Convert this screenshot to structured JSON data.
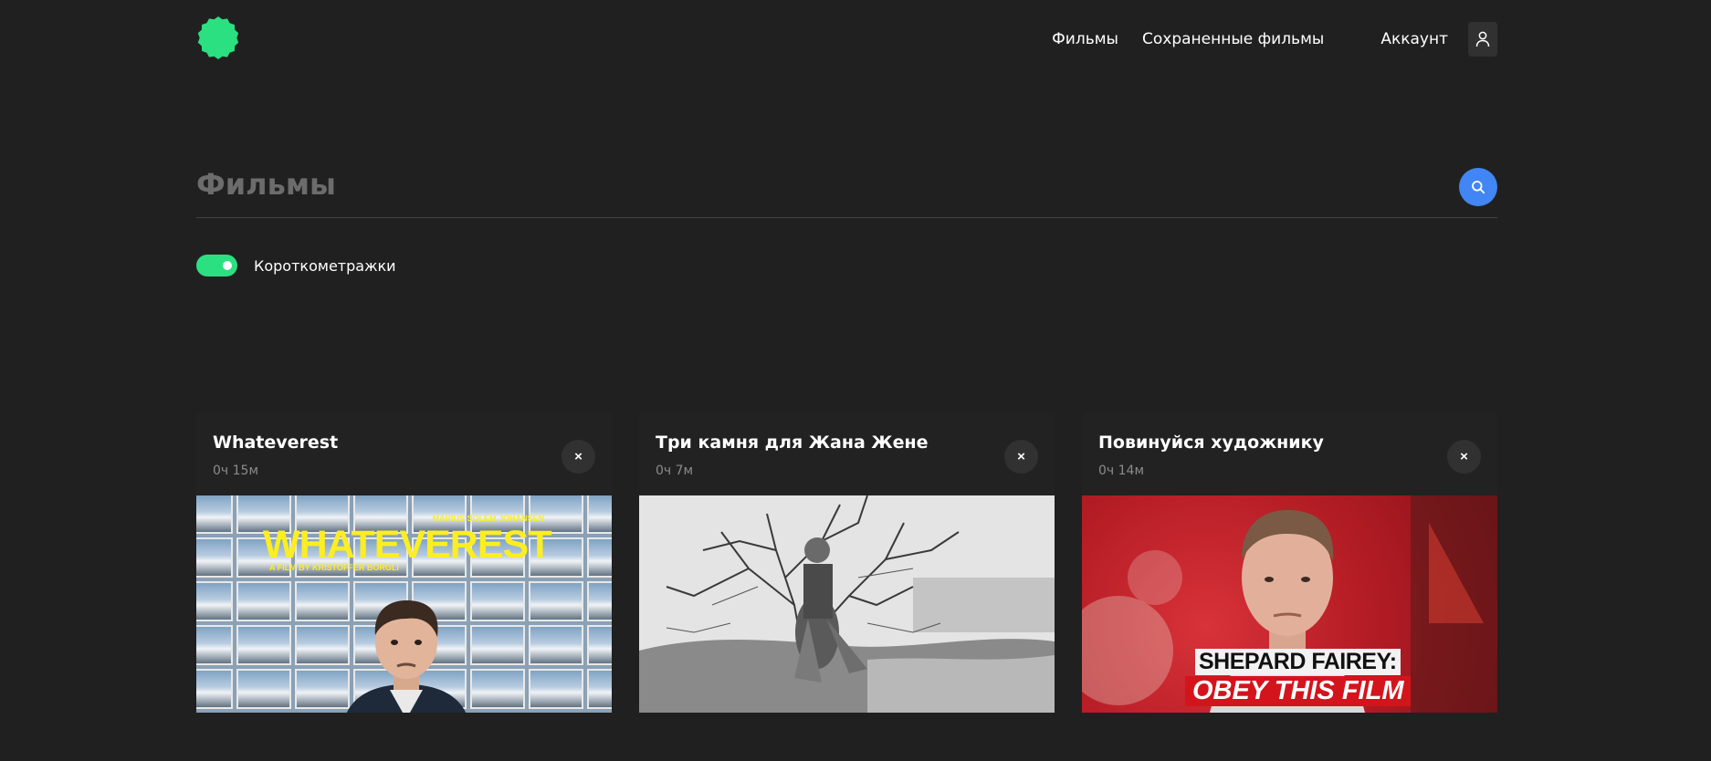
{
  "header": {
    "logo_icon": "green-badge-icon",
    "nav": {
      "films": "Фильмы",
      "saved_films": "Сохраненные фильмы",
      "account": "Аккаунт"
    },
    "account_icon": "user-icon"
  },
  "search": {
    "placeholder": "Фильмы",
    "button_icon": "search-icon"
  },
  "filter": {
    "short_films_label": "Короткометражки",
    "short_films_enabled": true
  },
  "cards": [
    {
      "title": "Whateverest",
      "duration": "0ч 15м",
      "remove_label": "×",
      "poster_text": {
        "director": "MARIUS SOLEM JOHANSEN",
        "title": "WHATEVEREST",
        "film_by": "A FILM BY KRISTOFFER BORGLI"
      }
    },
    {
      "title": "Три камня для Жана Жене",
      "duration": "0ч 7м",
      "remove_label": "×"
    },
    {
      "title": "Повинуйся художнику",
      "duration": "0ч 14м",
      "remove_label": "×",
      "poster_text": {
        "line1": "SHEPARD FAIREY:",
        "line2": "OBEY THIS FILM"
      }
    }
  ],
  "colors": {
    "background": "#202020",
    "accent_green": "#2be080",
    "search_blue": "#4285f4"
  }
}
